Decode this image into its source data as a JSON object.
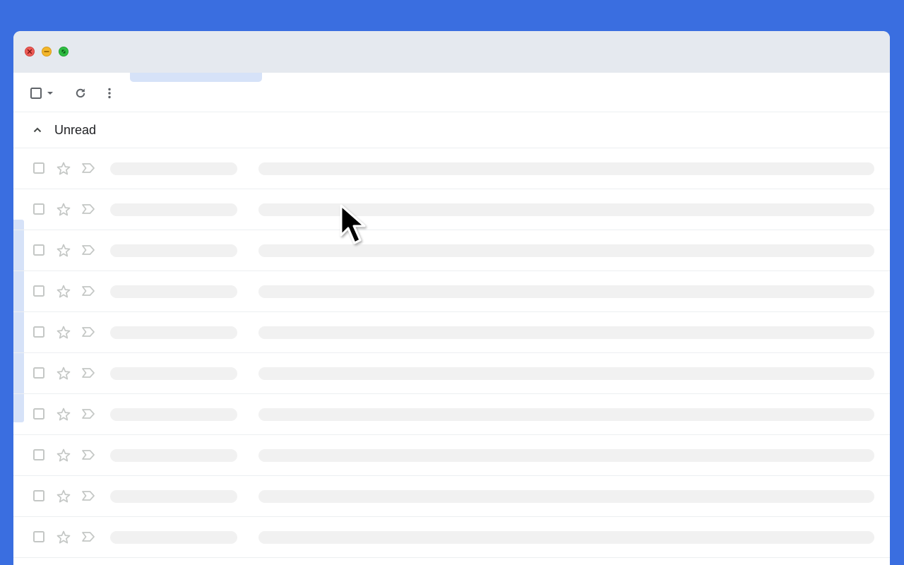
{
  "window": {
    "controls": [
      "close-icon",
      "minimize-icon",
      "maximize-icon"
    ]
  },
  "toolbar": {
    "select_icon": "checkbox-icon",
    "select_dropdown_icon": "caret-down-icon",
    "refresh_icon": "refresh-icon",
    "more_icon": "more-vertical-icon"
  },
  "section": {
    "title": "Unread",
    "collapse_icon": "chevron-up-icon"
  },
  "rows": [
    {
      "checkbox": "checkbox-icon",
      "star": "star-outline-icon",
      "important": "important-outline-icon"
    },
    {
      "checkbox": "checkbox-icon",
      "star": "star-outline-icon",
      "important": "important-outline-icon"
    },
    {
      "checkbox": "checkbox-icon",
      "star": "star-outline-icon",
      "important": "important-outline-icon"
    },
    {
      "checkbox": "checkbox-icon",
      "star": "star-outline-icon",
      "important": "important-outline-icon"
    },
    {
      "checkbox": "checkbox-icon",
      "star": "star-outline-icon",
      "important": "important-outline-icon"
    },
    {
      "checkbox": "checkbox-icon",
      "star": "star-outline-icon",
      "important": "important-outline-icon"
    },
    {
      "checkbox": "checkbox-icon",
      "star": "star-outline-icon",
      "important": "important-outline-icon"
    },
    {
      "checkbox": "checkbox-icon",
      "star": "star-outline-icon",
      "important": "important-outline-icon"
    },
    {
      "checkbox": "checkbox-icon",
      "star": "star-outline-icon",
      "important": "important-outline-icon"
    },
    {
      "checkbox": "checkbox-icon",
      "star": "star-outline-icon",
      "important": "important-outline-icon"
    }
  ],
  "colors": {
    "background": "#3a6ee0",
    "titlebar": "#e5e9ef",
    "placeholder": "#f1f1f1",
    "accent_light": "#d6e2f8",
    "close": "#ec5b56",
    "minimize": "#f3b62b",
    "maximize": "#2fbe43"
  },
  "cursor": "arrow-cursor-icon"
}
